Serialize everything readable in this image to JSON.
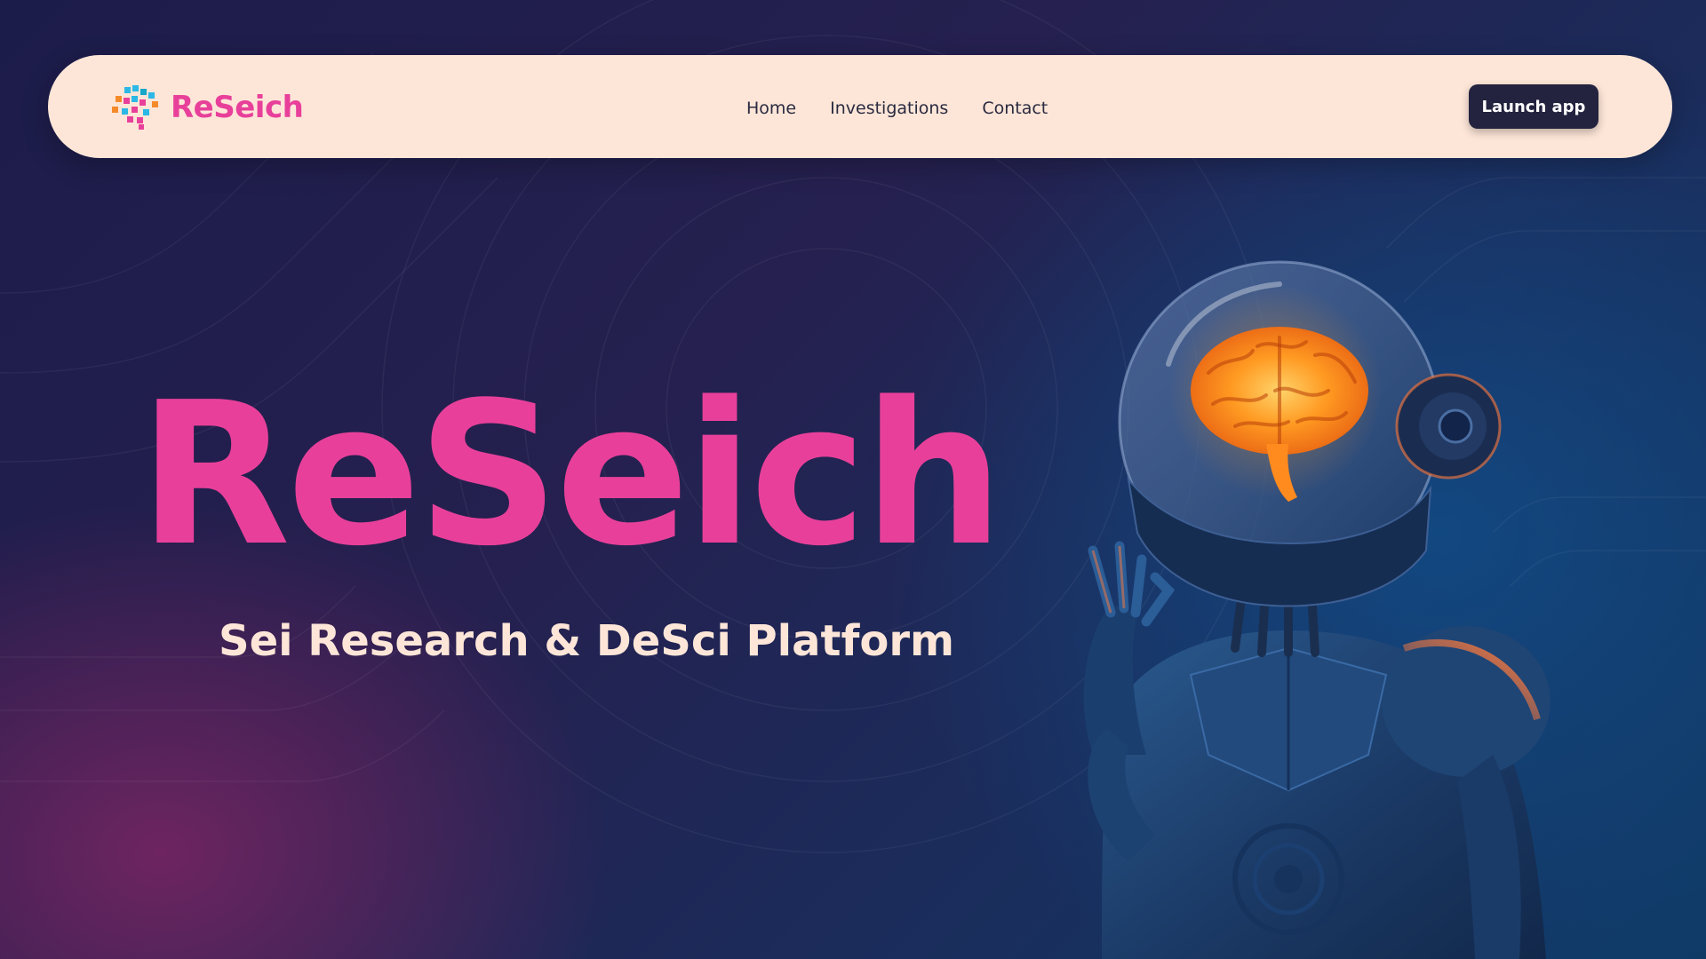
{
  "brand": {
    "name": "ReSeich",
    "logo_icon": "pixel-brain-logo-icon"
  },
  "nav": {
    "links": [
      "Home",
      "Investigations",
      "Contact"
    ],
    "cta_label": "Launch app"
  },
  "hero": {
    "title": "ReSeich",
    "subtitle": "Sei Research & DeSci Platform",
    "illustration": "robot-with-glowing-brain-illustration"
  },
  "colors": {
    "accent_pink": "#e8409a",
    "nav_background": "#fde6d8",
    "button_dark": "#23233f",
    "brain_orange": "#ff8a1e",
    "bg_navy": "#1c1c4a",
    "bg_blue": "#0f3a66"
  }
}
